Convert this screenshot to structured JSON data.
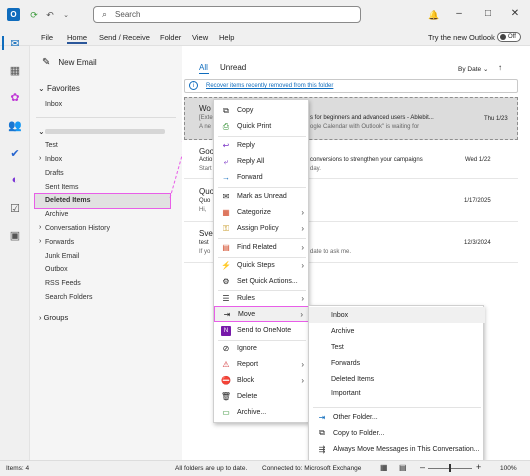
{
  "search": {
    "placeholder": "Search"
  },
  "ribbon": {
    "tabs": [
      "File",
      "Home",
      "Send / Receive",
      "Folder",
      "View",
      "Help"
    ],
    "try_new_outlook": "Try the new Outlook",
    "toggle_label": "Off"
  },
  "nav": {
    "new_email": "New Email",
    "favorites": "Favorites",
    "favorites_items": [
      "Inbox"
    ],
    "folders": [
      "Test",
      "Inbox",
      "Drafts",
      "Sent Items",
      "Deleted Items",
      "Archive",
      "Conversation History",
      "Forwards",
      "Junk Email",
      "Outbox",
      "RSS Feeds",
      "Search Folders"
    ],
    "groups": "Groups"
  },
  "list": {
    "tab_all": "All",
    "tab_unread": "Unread",
    "sort": "By Date",
    "recover_link": "Recover items recently removed from this folder",
    "emails": [
      {
        "sender": "Wo",
        "subject": "s for beginners and advanced users - Ablebit...",
        "preview": "ogle Calendar with Outlook\" is waiting for",
        "date": "Thu 1/23",
        "prefix1": "[Exte",
        "prefix2": "A ne"
      },
      {
        "sender": "Goo",
        "subject": "conversions to strengthen your campaigns",
        "preview": "day.",
        "date": "Wed 1/22",
        "prefix1": "Actio",
        "prefix2": "Start"
      },
      {
        "sender": "Quo",
        "subject": "",
        "preview": "",
        "date": "1/17/2025",
        "prefix1": "Quo",
        "prefix2": "Hi,"
      },
      {
        "sender": "Sve",
        "subject": "",
        "preview": "date to ask me.",
        "date": "12/3/2024",
        "prefix1": "test",
        "prefix2": "If yo"
      }
    ]
  },
  "context_menu": {
    "items": [
      "Copy",
      "Quick Print",
      "Reply",
      "Reply All",
      "Forward",
      "Mark as Unread",
      "Categorize",
      "Assign Policy",
      "Find Related",
      "Quick Steps",
      "Set Quick Actions...",
      "Rules",
      "Move",
      "Send to OneNote",
      "Ignore",
      "Report",
      "Block",
      "Delete",
      "Archive..."
    ]
  },
  "submenu": {
    "folders": [
      "Inbox",
      "Archive",
      "Test",
      "Forwards",
      "Deleted Items",
      "Important"
    ],
    "actions": [
      "Other Folder...",
      "Copy to Folder...",
      "Always Move Messages in This Conversation..."
    ]
  },
  "status": {
    "items": "Items: 4",
    "uptodate": "All folders are up to date.",
    "connected": "Connected to: Microsoft Exchange",
    "zoom": "100%"
  },
  "colors": {
    "accent": "#0f6cbd",
    "highlight": "#e85ee8"
  }
}
